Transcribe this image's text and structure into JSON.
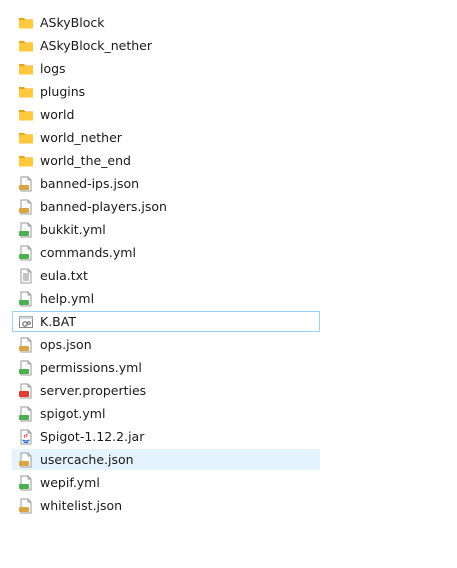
{
  "colors": {
    "hover_bg": "#e5f3ff",
    "focus_border": "#99d1ff",
    "folder": "#ffc83d",
    "folder_tab": "#e8a317",
    "json_badge": "#d9a441",
    "yml_badge": "#4caf50",
    "cfg_badge": "#e53935"
  },
  "files": [
    {
      "name": "ASkyBlock",
      "icon": "folder-icon",
      "state": ""
    },
    {
      "name": "ASkyBlock_nether",
      "icon": "folder-icon",
      "state": ""
    },
    {
      "name": "logs",
      "icon": "folder-icon",
      "state": ""
    },
    {
      "name": "plugins",
      "icon": "folder-icon",
      "state": ""
    },
    {
      "name": "world",
      "icon": "folder-icon",
      "state": ""
    },
    {
      "name": "world_nether",
      "icon": "folder-icon",
      "state": ""
    },
    {
      "name": "world_the_end",
      "icon": "folder-icon",
      "state": ""
    },
    {
      "name": "banned-ips.json",
      "icon": "json-file-icon",
      "state": ""
    },
    {
      "name": "banned-players.json",
      "icon": "json-file-icon",
      "state": ""
    },
    {
      "name": "bukkit.yml",
      "icon": "yml-file-icon",
      "state": ""
    },
    {
      "name": "commands.yml",
      "icon": "yml-file-icon",
      "state": ""
    },
    {
      "name": "eula.txt",
      "icon": "text-file-icon",
      "state": ""
    },
    {
      "name": "help.yml",
      "icon": "yml-file-icon",
      "state": ""
    },
    {
      "name": "K.BAT",
      "icon": "batch-file-icon",
      "state": "focused"
    },
    {
      "name": "ops.json",
      "icon": "json-file-icon",
      "state": ""
    },
    {
      "name": "permissions.yml",
      "icon": "yml-file-icon",
      "state": ""
    },
    {
      "name": "server.properties",
      "icon": "properties-file-icon",
      "state": ""
    },
    {
      "name": "spigot.yml",
      "icon": "yml-file-icon",
      "state": ""
    },
    {
      "name": "Spigot-1.12.2.jar",
      "icon": "jar-file-icon",
      "state": ""
    },
    {
      "name": "usercache.json",
      "icon": "json-file-icon",
      "state": "hover"
    },
    {
      "name": "wepif.yml",
      "icon": "yml-file-icon",
      "state": ""
    },
    {
      "name": "whitelist.json",
      "icon": "json-file-icon",
      "state": ""
    }
  ]
}
